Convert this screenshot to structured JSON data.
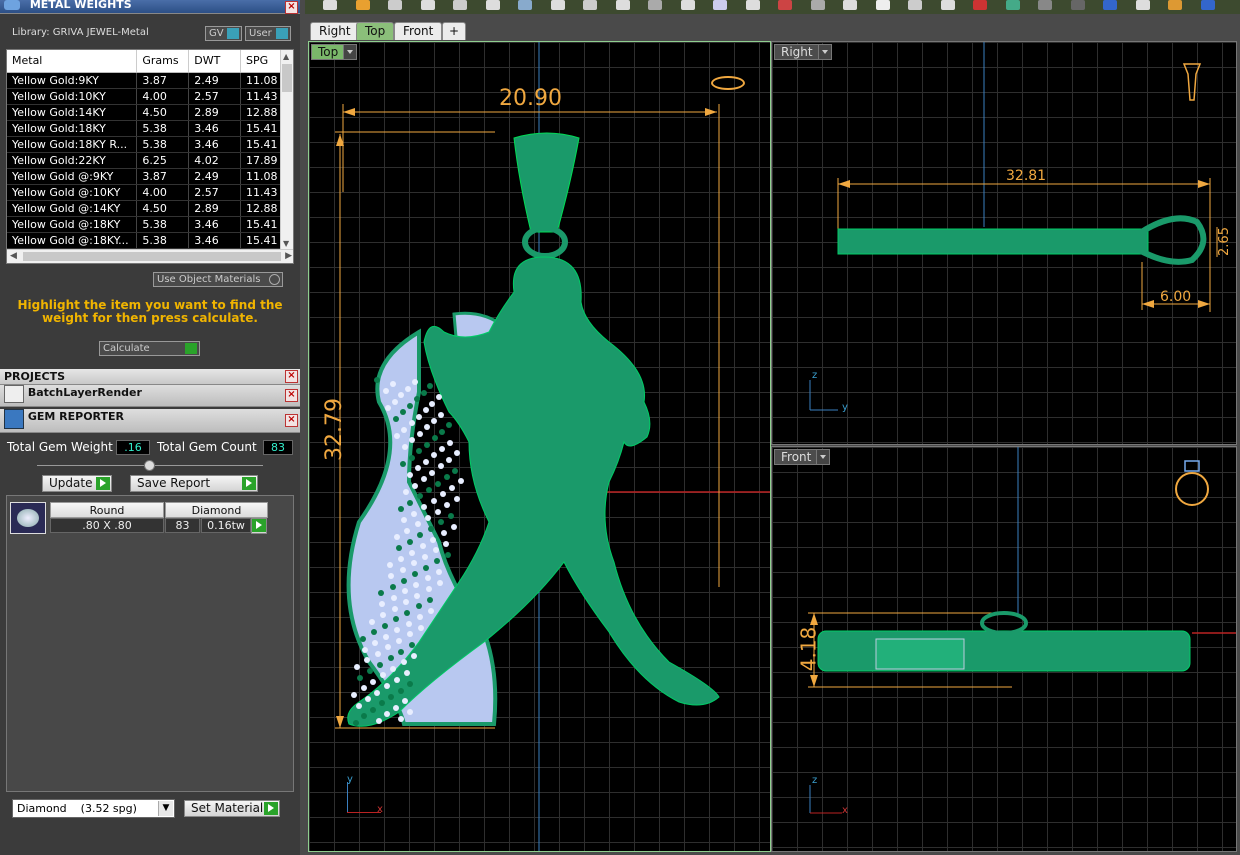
{
  "metal_weights": {
    "title": "METAL WEIGHTS",
    "library": "Library: GRIVA JEWEL-Metal",
    "toggle_gv": "GV",
    "toggle_user": "User",
    "columns": [
      "Metal",
      "Grams",
      "DWT",
      "SPG"
    ],
    "rows": [
      [
        "Yellow Gold:9KY",
        "3.87",
        "2.49",
        "11.08"
      ],
      [
        "Yellow Gold:10KY",
        "4.00",
        "2.57",
        "11.43"
      ],
      [
        "Yellow Gold:14KY",
        "4.50",
        "2.89",
        "12.88"
      ],
      [
        "Yellow Gold:18KY",
        "5.38",
        "3.46",
        "15.41"
      ],
      [
        "Yellow Gold:18KY R...",
        "5.38",
        "3.46",
        "15.41"
      ],
      [
        "Yellow Gold:22KY",
        "6.25",
        "4.02",
        "17.89"
      ],
      [
        "Yellow Gold @:9KY",
        "3.87",
        "2.49",
        "11.08"
      ],
      [
        "Yellow Gold @:10KY",
        "4.00",
        "2.57",
        "11.43"
      ],
      [
        "Yellow Gold @:14KY",
        "4.50",
        "2.89",
        "12.88"
      ],
      [
        "Yellow Gold @:18KY",
        "5.38",
        "3.46",
        "15.41"
      ],
      [
        "Yellow Gold @:18KY...",
        "5.38",
        "3.46",
        "15.41"
      ]
    ],
    "use_object_materials": "Use Object Materials",
    "note": "Highlight the item you want to find the weight for then press calculate.",
    "calculate": "Calculate"
  },
  "projects": {
    "title": "PROJECTS",
    "batch_layer_render": "BatchLayerRender",
    "gem_reporter": "GEM REPORTER"
  },
  "gem_reporter": {
    "total_weight_label": "Total Gem Weight",
    "total_weight": ".16",
    "total_count_label": "Total Gem Count",
    "total_count": "83",
    "update": "Update",
    "save_report": "Save Report",
    "shape": "Round",
    "stone": "Diamond",
    "size": ".80 X .80",
    "count": "83",
    "weight": "0.16tw",
    "material_select": "Diamond    (3.52 spg)",
    "set_material": "Set Material"
  },
  "tabs": [
    "Right",
    "Top",
    "Front"
  ],
  "viewports": {
    "top": {
      "label": "Top",
      "width_dim": "20.90",
      "height_dim": "32.79",
      "axis_y": "y",
      "axis_x": "x"
    },
    "right": {
      "label": "Right",
      "length_dim": "32.81",
      "thickness_dim": "2.65",
      "bail_dim": "6.00",
      "axis_z": "z",
      "axis_y": "y"
    },
    "front": {
      "label": "Front",
      "height_dim": "4.18",
      "axis_z": "z",
      "axis_x": "x"
    }
  },
  "colors": {
    "model": "#1a9a6a",
    "dimension": "#f0a840",
    "gem": "#c8d8ff",
    "accent_tab": "#8bbf7a"
  }
}
